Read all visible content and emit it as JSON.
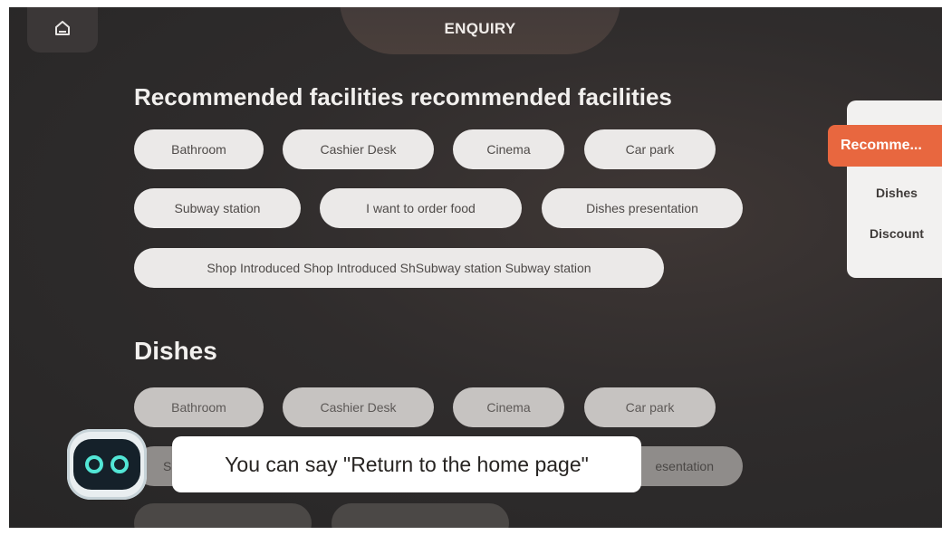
{
  "header": {
    "title": "ENQUIRY",
    "home_icon": "home-icon"
  },
  "sections": [
    {
      "title": "Recommended facilities recommended facilities",
      "chips": [
        "Bathroom",
        "Cashier Desk",
        "Cinema",
        "Car park",
        "Subway station",
        "I want to order food",
        "Dishes presentation",
        "Shop Introduced Shop Introduced ShSubway station Subway station"
      ]
    },
    {
      "title": "Dishes",
      "chips": [
        "Bathroom",
        "Cashier Desk",
        "Cinema",
        "Car park",
        "S",
        "esentation"
      ]
    }
  ],
  "side_nav": {
    "items": [
      "Recomme...",
      "Dishes",
      "Discount"
    ],
    "active_index": 0,
    "active_color": "#e8673f"
  },
  "assistant": {
    "avatar_icon": "robot-icon",
    "prompt": "You can say \"Return to the home page\""
  }
}
